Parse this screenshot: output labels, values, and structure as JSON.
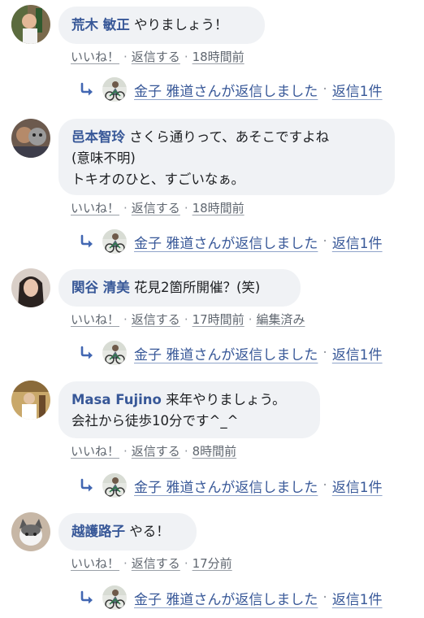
{
  "colors": {
    "link": "#385898",
    "meta": "#606770",
    "bubble": "#f0f2f5"
  },
  "icons": {
    "reply_arrow": "reply-arrow-icon"
  },
  "separator": "·",
  "comments": [
    {
      "author": "荒木 敏正",
      "text_lines": [
        "やりましょう！"
      ],
      "like": "いいね！",
      "reply": "返信する",
      "time": "18時間前",
      "edited": "",
      "replied_by": "金子 雅道さんが返信しました",
      "reply_count": "返信1件"
    },
    {
      "author": "邑本智玲",
      "text_lines": [
        "さくら通りって、あそこですよね",
        "(意味不明)",
        "トキオのひと、すごいなぁ。"
      ],
      "like": "いいね！",
      "reply": "返信する",
      "time": "18時間前",
      "edited": "",
      "replied_by": "金子 雅道さんが返信しました",
      "reply_count": "返信1件"
    },
    {
      "author": "関谷 清美",
      "text_lines": [
        "花見2箇所開催？(笑)"
      ],
      "like": "いいね！",
      "reply": "返信する",
      "time": "17時間前",
      "edited": "編集済み",
      "replied_by": "金子 雅道さんが返信しました",
      "reply_count": "返信1件"
    },
    {
      "author": "Masa Fujino",
      "text_lines": [
        "来年やりましょう。",
        "会社から徒歩10分です^_^"
      ],
      "like": "いいね！",
      "reply": "返信する",
      "time": "8時間前",
      "edited": "",
      "replied_by": "金子 雅道さんが返信しました",
      "reply_count": "返信1件"
    },
    {
      "author": "越護路子",
      "text_lines": [
        "やる！"
      ],
      "like": "いいね！",
      "reply": "返信する",
      "time": "17分前",
      "edited": "",
      "replied_by": "金子 雅道さんが返信しました",
      "reply_count": "返信1件"
    }
  ]
}
